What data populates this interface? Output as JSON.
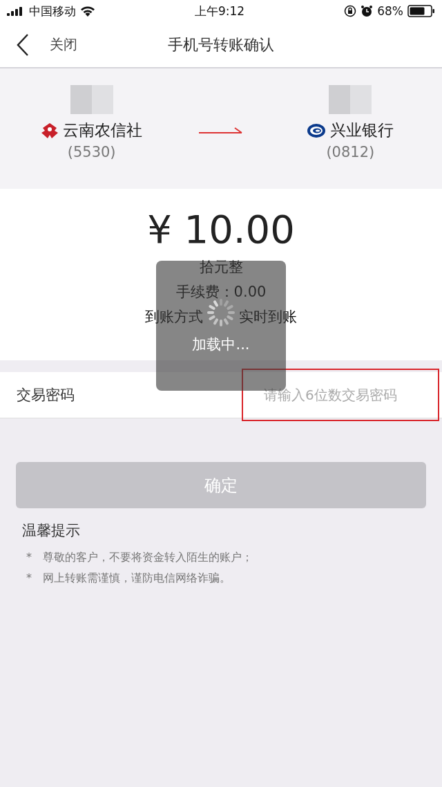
{
  "status_bar": {
    "carrier": "中国移动",
    "time": "上午9:12",
    "battery": "68%"
  },
  "nav": {
    "back_label": "关闭",
    "title": "手机号转账确认"
  },
  "transfer": {
    "from": {
      "bank": "云南农信社",
      "account": "(5530)"
    },
    "to": {
      "bank": "兴业银行",
      "account": "(0812)"
    }
  },
  "amount": {
    "value": "¥ 10.00",
    "in_words": "拾元整",
    "fee": "手续费：0.00",
    "arrival_label": "到账方式",
    "arrival_value": "实时到账"
  },
  "password": {
    "label": "交易密码",
    "placeholder": "请输入6位数交易密码",
    "highlighted": true
  },
  "confirm_button": {
    "label": "确定",
    "disabled": true
  },
  "tips": {
    "title": "温馨提示",
    "items": [
      {
        "bullet": "*",
        "text": "尊敬的客户，不要将资金转入陌生的账户；"
      },
      {
        "bullet": "*",
        "text": "网上转账需谨慎，谨防电信网络诈骗。"
      }
    ]
  },
  "loading": {
    "visible": true,
    "text": "加载中..."
  }
}
